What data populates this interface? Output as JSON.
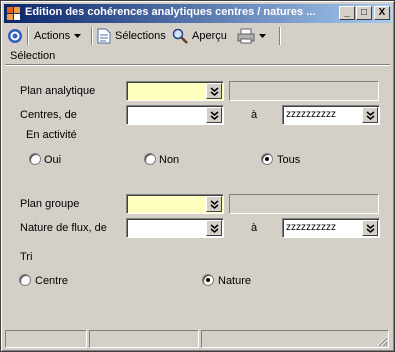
{
  "window": {
    "title": "Edition des cohérences analytiques centres / natures ...",
    "min_label": "_",
    "max_label": "□",
    "close_label": "X"
  },
  "toolbar": {
    "actions_label": "Actions",
    "selections_label": "Sélections",
    "apercu_label": "Aperçu"
  },
  "selection": {
    "title": "Sélection",
    "plan_analytique_label": "Plan analytique",
    "centres_label": "Centres, de",
    "centres_a_label": "à",
    "centres_to_value": "zzzzzzzzzz",
    "en_activite_label": "En activité",
    "radio_oui": "Oui",
    "radio_non": "Non",
    "radio_tous": "Tous",
    "plan_groupe_label": "Plan groupe",
    "nature_flux_label": "Nature de flux, de",
    "nature_a_label": "à",
    "nature_to_value": "zzzzzzzzzz",
    "tri_label": "Tri",
    "radio_centre": "Centre",
    "radio_nature": "Nature"
  },
  "colors": {
    "required_field": "#ffffc0",
    "titlebar_start": "#0a246a",
    "titlebar_end": "#a6caf0"
  }
}
